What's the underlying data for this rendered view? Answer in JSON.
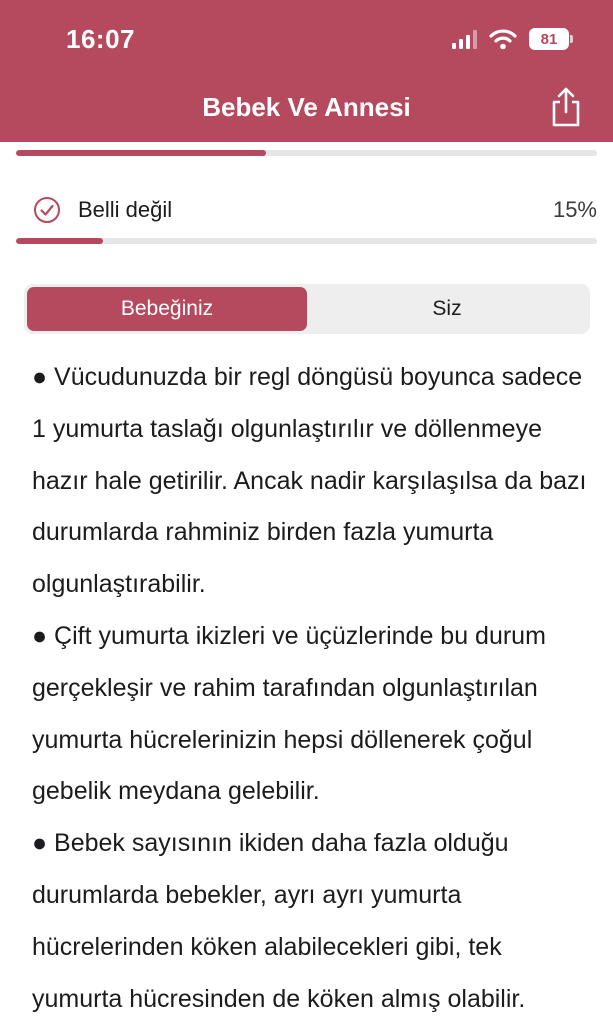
{
  "status_bar": {
    "time": "16:07",
    "battery": "81"
  },
  "nav": {
    "title": "Bebek Ve Annesi"
  },
  "progress": {
    "top_fill_pct": 43,
    "answer_fill_pct": 15
  },
  "answer": {
    "label": "Belli değil",
    "percent": "15%"
  },
  "tabs": [
    {
      "label": "Bebeğiniz",
      "active": true
    },
    {
      "label": "Siz",
      "active": false
    }
  ],
  "article": {
    "paragraphs": [
      "● Vücudunuzda bir regl döngüsü boyunca sadece 1 yumurta taslağı olgunlaştırılır ve döllenmeye hazır hale getirilir. Ancak nadir karşılaşılsa da bazı durumlarda rahminiz birden fazla yumurta olgunlaştırabilir.",
      "● Çift yumurta ikizleri ve üçüzlerinde bu durum gerçekleşir ve rahim tarafından olgunlaştırılan yumurta hücrelerinizin hepsi döllenerek çoğul gebelik meydana gelebilir.",
      "● Bebek sayısının ikiden daha fazla olduğu durumlarda bebekler, ayrı ayrı yumurta hücrelerinden köken alabilecekleri gibi, tek yumurta hücresinden de köken almış olabilir."
    ]
  },
  "colors": {
    "accent": "#b5495e",
    "track": "#e6e6e8",
    "segment_bg": "#eeeeef"
  },
  "icons": {
    "share": "share-icon",
    "check": "check-circle-icon",
    "wifi": "wifi-icon",
    "signal": "cellular-signal-icon",
    "battery": "battery-icon"
  }
}
